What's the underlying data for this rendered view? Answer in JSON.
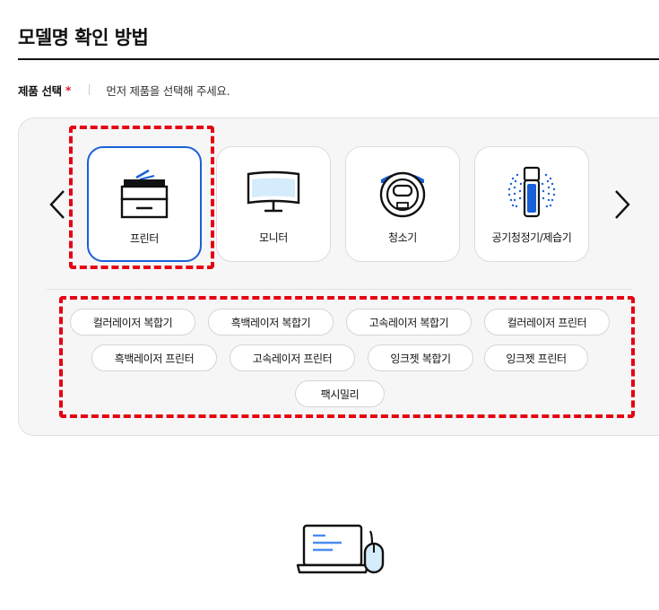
{
  "header": {
    "title": "모델명 확인 방법"
  },
  "product_select": {
    "label": "제품 선택",
    "required_mark": "*",
    "guide": "먼저 제품을 선택해 주세요."
  },
  "carousel": {
    "selected_index": 0,
    "categories": [
      {
        "label": "프린터",
        "icon": "printer-icon"
      },
      {
        "label": "모니터",
        "icon": "monitor-icon"
      },
      {
        "label": "청소기",
        "icon": "robot-vacuum-icon"
      },
      {
        "label": "공기청정기/제습기",
        "icon": "air-purifier-icon"
      }
    ]
  },
  "subcategories": [
    "컬러레이저 복합기",
    "흑백레이저 복합기",
    "고속레이저 복합기",
    "컬러레이저 프린터",
    "흑백레이저 프린터",
    "고속레이저 프린터",
    "잉크젯 복합기",
    "잉크젯 프린터",
    "팩시밀리"
  ],
  "colors": {
    "accent_blue": "#1760d8",
    "required_red": "#e0202c",
    "highlight_red": "#e60012"
  }
}
